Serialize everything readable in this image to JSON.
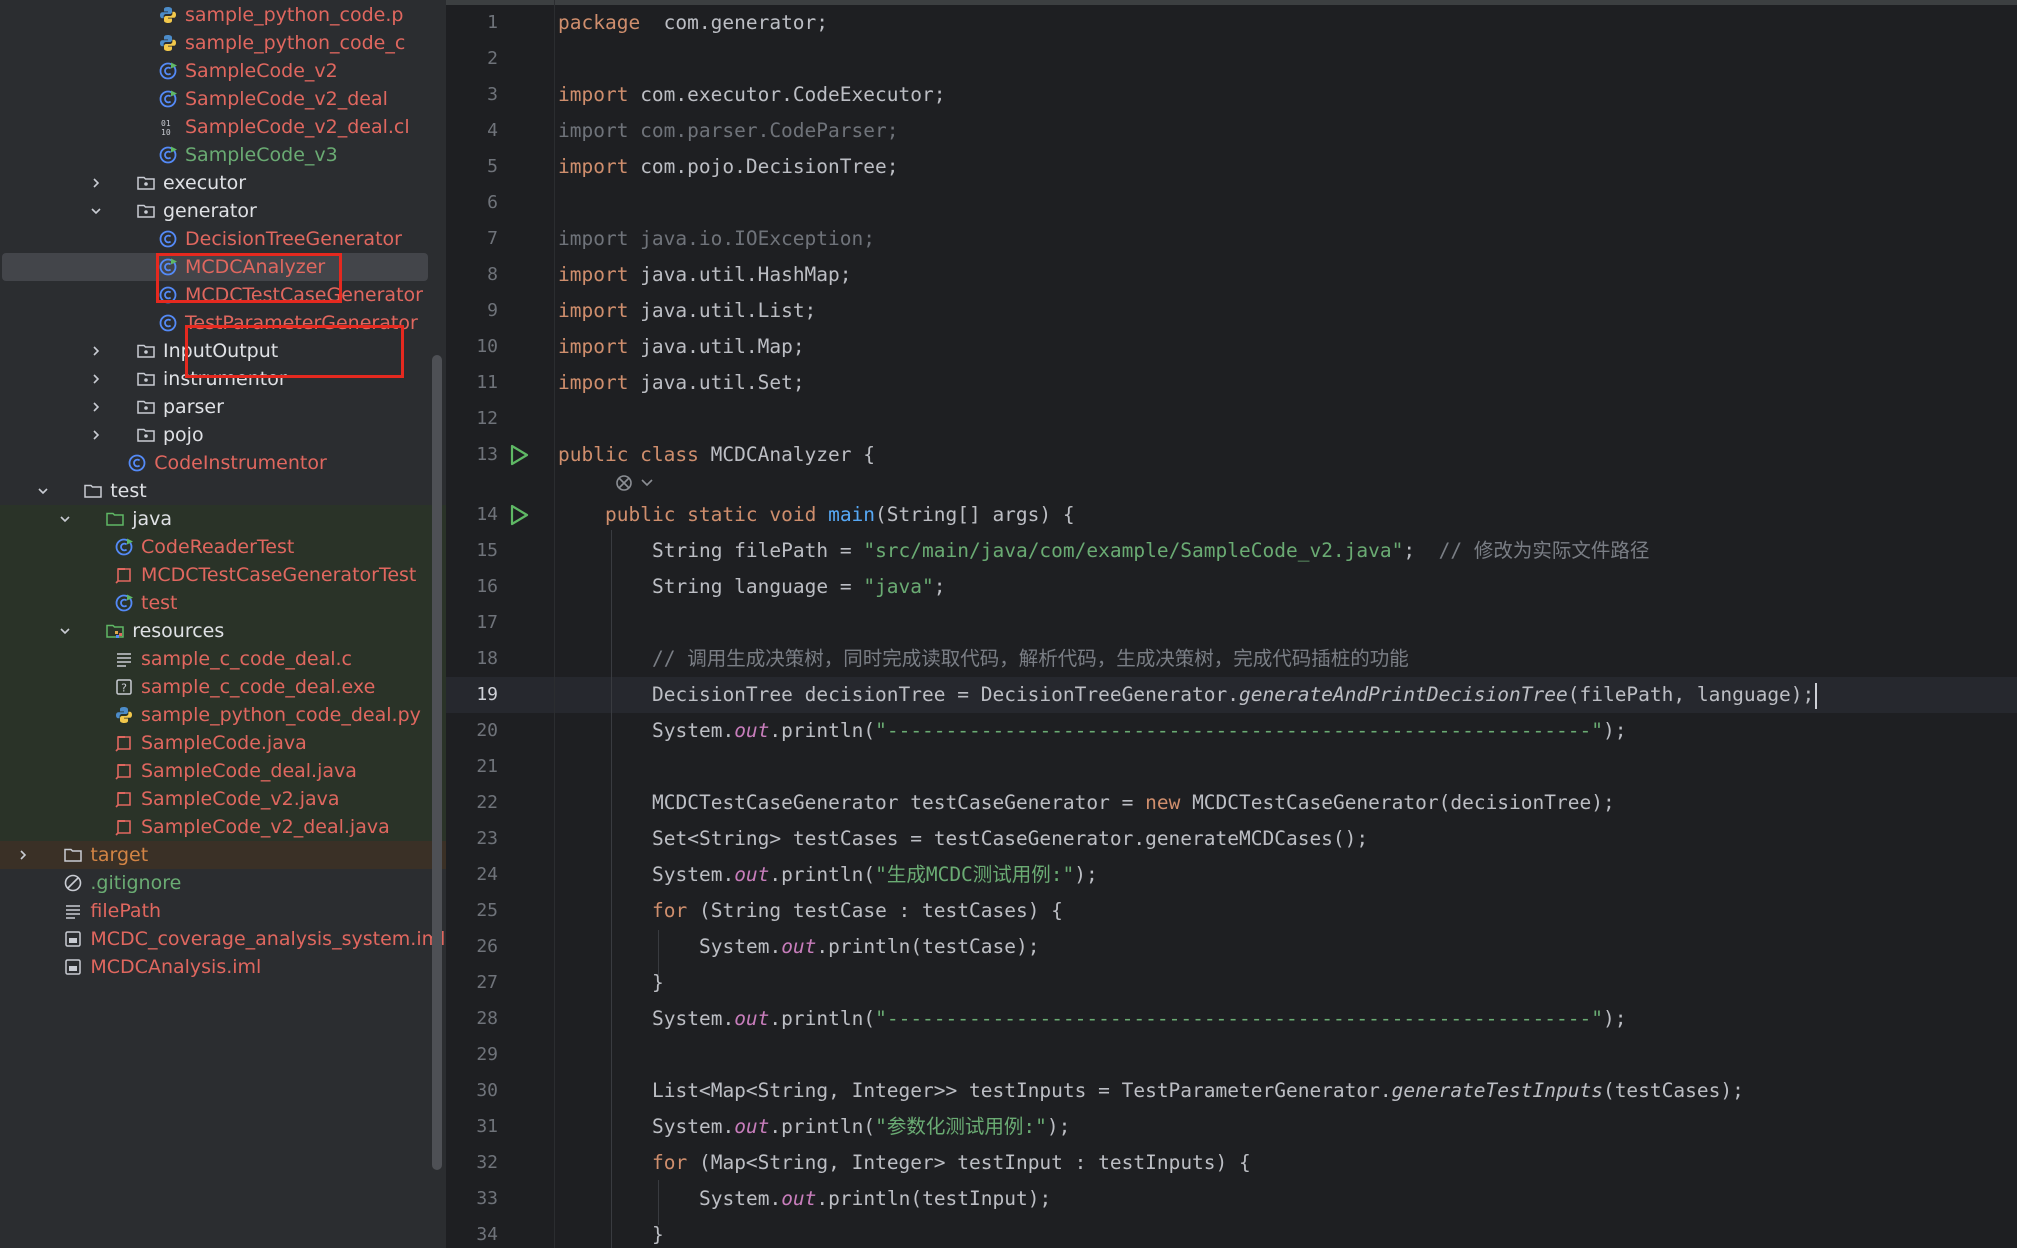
{
  "tree": {
    "items": [
      {
        "label": "sample_python_code.p",
        "icon": "python-file-icon",
        "color": "red",
        "indent": 2,
        "arrow": "none",
        "bg": "none"
      },
      {
        "label": "sample_python_code_c",
        "icon": "python-file-icon",
        "color": "red",
        "indent": 2,
        "arrow": "none",
        "bg": "none"
      },
      {
        "label": "SampleCode_v2",
        "icon": "java-class-runnable-icon",
        "color": "red",
        "indent": 2,
        "arrow": "none",
        "bg": "none"
      },
      {
        "label": "SampleCode_v2_deal",
        "icon": "java-class-runnable-icon",
        "color": "red",
        "indent": 2,
        "arrow": "none",
        "bg": "none"
      },
      {
        "label": "SampleCode_v2_deal.cl",
        "icon": "binary-file-icon",
        "color": "red",
        "indent": 2,
        "arrow": "none",
        "bg": "none"
      },
      {
        "label": "SampleCode_v3",
        "icon": "java-class-runnable-icon",
        "color": "green",
        "indent": 2,
        "arrow": "none",
        "bg": "none"
      },
      {
        "label": "executor",
        "icon": "package-folder-icon",
        "color": "normal",
        "indent": 1,
        "arrow": "right",
        "bg": "none"
      },
      {
        "label": "generator",
        "icon": "package-folder-icon",
        "color": "normal",
        "indent": 1,
        "arrow": "down",
        "bg": "none"
      },
      {
        "label": "DecisionTreeGenerator",
        "icon": "java-class-icon",
        "color": "red",
        "indent": 2,
        "arrow": "none",
        "bg": "none"
      },
      {
        "label": "MCDCAnalyzer",
        "icon": "java-class-runnable-icon",
        "color": "red",
        "indent": 2,
        "arrow": "none",
        "bg": "none",
        "selected": true
      },
      {
        "label": "MCDCTestCaseGenerator",
        "icon": "java-class-icon",
        "color": "red",
        "indent": 2,
        "arrow": "none",
        "bg": "none"
      },
      {
        "label": "TestParameterGenerator",
        "icon": "java-class-icon",
        "color": "red",
        "indent": 2,
        "arrow": "none",
        "bg": "none"
      },
      {
        "label": "InputOutput",
        "icon": "package-folder-icon",
        "color": "normal",
        "indent": 1,
        "arrow": "right",
        "bg": "none"
      },
      {
        "label": "instrumentor",
        "icon": "package-folder-icon",
        "color": "normal",
        "indent": 1,
        "arrow": "right",
        "bg": "none"
      },
      {
        "label": "parser",
        "icon": "package-folder-icon",
        "color": "normal",
        "indent": 1,
        "arrow": "right",
        "bg": "none"
      },
      {
        "label": "pojo",
        "icon": "package-folder-icon",
        "color": "normal",
        "indent": 1,
        "arrow": "right",
        "bg": "none"
      },
      {
        "label": "CodeInstrumentor",
        "icon": "java-class-icon",
        "color": "red",
        "indent": 0.6,
        "arrow": "none",
        "bg": "none"
      },
      {
        "label": "test",
        "icon": "folder-icon",
        "color": "normal",
        "indent": -1.4,
        "arrow": "down",
        "bg": "none"
      },
      {
        "label": "java",
        "icon": "test-folder-icon",
        "color": "normal",
        "indent": -0.4,
        "arrow": "down",
        "bg": "green"
      },
      {
        "label": "CodeReaderTest",
        "icon": "java-class-runnable-icon",
        "color": "red",
        "indent": 0,
        "arrow": "none",
        "bg": "green"
      },
      {
        "label": "MCDCTestCaseGeneratorTest",
        "icon": "java-file-icon",
        "color": "red",
        "indent": 0,
        "arrow": "none",
        "bg": "green"
      },
      {
        "label": "test",
        "icon": "java-class-runnable-icon",
        "color": "red",
        "indent": 0,
        "arrow": "none",
        "bg": "green"
      },
      {
        "label": "resources",
        "icon": "resources-folder-icon",
        "color": "normal",
        "indent": -0.4,
        "arrow": "down",
        "bg": "green"
      },
      {
        "label": "sample_c_code_deal.c",
        "icon": "text-file-icon",
        "color": "red",
        "indent": 0,
        "arrow": "none",
        "bg": "green"
      },
      {
        "label": "sample_c_code_deal.exe",
        "icon": "unknown-file-icon",
        "color": "red",
        "indent": 0,
        "arrow": "none",
        "bg": "green"
      },
      {
        "label": "sample_python_code_deal.py",
        "icon": "python-file-icon",
        "color": "red",
        "indent": 0,
        "arrow": "none",
        "bg": "green"
      },
      {
        "label": "SampleCode.java",
        "icon": "java-file-icon",
        "color": "red",
        "indent": 0,
        "arrow": "none",
        "bg": "green"
      },
      {
        "label": "SampleCode_deal.java",
        "icon": "java-file-icon",
        "color": "red",
        "indent": 0,
        "arrow": "none",
        "bg": "green"
      },
      {
        "label": "SampleCode_v2.java",
        "icon": "java-file-icon",
        "color": "red",
        "indent": 0,
        "arrow": "none",
        "bg": "green"
      },
      {
        "label": "SampleCode_v2_deal.java",
        "icon": "java-file-icon",
        "color": "red",
        "indent": 0,
        "arrow": "none",
        "bg": "green"
      },
      {
        "label": "target",
        "icon": "folder-icon",
        "color": "orange",
        "indent": -2.3,
        "arrow": "right",
        "bg": "orange"
      },
      {
        "label": ".gitignore",
        "icon": "ignore-file-icon",
        "color": "green",
        "indent": -2.3,
        "arrow": "none",
        "bg": "none"
      },
      {
        "label": "filePath",
        "icon": "text-file-icon",
        "color": "red",
        "indent": -2.3,
        "arrow": "none",
        "bg": "none"
      },
      {
        "label": "MCDC_coverage_analysis_system.iml",
        "icon": "module-file-icon",
        "color": "red",
        "indent": -2.3,
        "arrow": "none",
        "bg": "none"
      },
      {
        "label": "MCDCAnalysis.iml",
        "icon": "module-file-icon",
        "color": "red",
        "indent": -2.3,
        "arrow": "none",
        "bg": "none"
      }
    ]
  },
  "editor": {
    "active_line": 19,
    "lines": [
      {
        "n": 1,
        "indent": 0,
        "parts": [
          [
            "kw",
            "package"
          ],
          [
            "",
            "  com.generator;"
          ]
        ]
      },
      {
        "n": 2,
        "indent": 0,
        "parts": []
      },
      {
        "n": 3,
        "indent": 0,
        "parts": [
          [
            "kw",
            "import"
          ],
          [
            "",
            " com.executor.CodeExecutor;"
          ]
        ]
      },
      {
        "n": 4,
        "indent": 0,
        "parts": [
          [
            "dim",
            "import com.parser.CodeParser;"
          ]
        ]
      },
      {
        "n": 5,
        "indent": 0,
        "parts": [
          [
            "kw",
            "import"
          ],
          [
            "",
            " com.pojo.DecisionTree;"
          ]
        ]
      },
      {
        "n": 6,
        "indent": 0,
        "parts": []
      },
      {
        "n": 7,
        "indent": 0,
        "parts": [
          [
            "dim",
            "import java.io.IOException;"
          ]
        ]
      },
      {
        "n": 8,
        "indent": 0,
        "parts": [
          [
            "kw",
            "import"
          ],
          [
            "",
            " java.util.HashMap;"
          ]
        ]
      },
      {
        "n": 9,
        "indent": 0,
        "parts": [
          [
            "kw",
            "import"
          ],
          [
            "",
            " java.util.List;"
          ]
        ]
      },
      {
        "n": 10,
        "indent": 0,
        "parts": [
          [
            "kw",
            "import"
          ],
          [
            "",
            " java.util.Map;"
          ]
        ]
      },
      {
        "n": 11,
        "indent": 0,
        "parts": [
          [
            "kw",
            "import"
          ],
          [
            "",
            " java.util.Set;"
          ]
        ]
      },
      {
        "n": 12,
        "indent": 0,
        "parts": []
      },
      {
        "n": 13,
        "indent": 0,
        "run": true,
        "parts": [
          [
            "kw",
            "public class"
          ],
          [
            "",
            " MCDCAnalyzer {"
          ]
        ]
      },
      {
        "n": 14,
        "indent": 1,
        "run": true,
        "parts": [
          [
            "kw",
            "public static void"
          ],
          [
            "",
            " "
          ],
          [
            "fn",
            "main"
          ],
          [
            "",
            "(String[] args) {"
          ]
        ]
      },
      {
        "n": 15,
        "indent": 2,
        "parts": [
          [
            "",
            "String filePath = "
          ],
          [
            "str",
            "\"src/main/java/com/example/SampleCode_v2.java\""
          ],
          [
            "",
            ";  "
          ],
          [
            "cmt",
            "// 修改为实际文件路径"
          ]
        ]
      },
      {
        "n": 16,
        "indent": 2,
        "parts": [
          [
            "",
            "String language = "
          ],
          [
            "str",
            "\"java\""
          ],
          [
            "",
            ";"
          ]
        ]
      },
      {
        "n": 17,
        "indent": 2,
        "parts": []
      },
      {
        "n": 18,
        "indent": 2,
        "parts": [
          [
            "cmt",
            "// 调用生成决策树，同时完成读取代码，解析代码，生成决策树，完成代码插桩的功能"
          ]
        ]
      },
      {
        "n": 19,
        "indent": 2,
        "caret": true,
        "parts": [
          [
            "",
            "DecisionTree decisionTree = DecisionTreeGenerator."
          ],
          [
            "it",
            "generateAndPrintDecisionTree"
          ],
          [
            "",
            "(filePath, language);"
          ]
        ]
      },
      {
        "n": 20,
        "indent": 2,
        "parts": [
          [
            "",
            "System."
          ],
          [
            "st",
            "out"
          ],
          [
            "",
            ".println("
          ],
          [
            "str",
            "\"------------------------------------------------------------\""
          ],
          [
            "",
            ");"
          ]
        ]
      },
      {
        "n": 21,
        "indent": 2,
        "parts": []
      },
      {
        "n": 22,
        "indent": 2,
        "parts": [
          [
            "",
            "MCDCTestCaseGenerator testCaseGenerator = "
          ],
          [
            "kw",
            "new"
          ],
          [
            "",
            " MCDCTestCaseGenerator(decisionTree);"
          ]
        ]
      },
      {
        "n": 23,
        "indent": 2,
        "parts": [
          [
            "",
            "Set<String> testCases = testCaseGenerator.generateMCDCases();"
          ]
        ]
      },
      {
        "n": 24,
        "indent": 2,
        "parts": [
          [
            "",
            "System."
          ],
          [
            "st",
            "out"
          ],
          [
            "",
            ".println("
          ],
          [
            "str",
            "\"生成MCDC测试用例:\""
          ],
          [
            "",
            ");"
          ]
        ]
      },
      {
        "n": 25,
        "indent": 2,
        "parts": [
          [
            "kw",
            "for"
          ],
          [
            "",
            " (String testCase : testCases) {"
          ]
        ]
      },
      {
        "n": 26,
        "indent": 3,
        "parts": [
          [
            "",
            "System."
          ],
          [
            "st",
            "out"
          ],
          [
            "",
            ".println(testCase);"
          ]
        ]
      },
      {
        "n": 27,
        "indent": 2,
        "parts": [
          [
            "",
            "}"
          ]
        ]
      },
      {
        "n": 28,
        "indent": 2,
        "parts": [
          [
            "",
            "System."
          ],
          [
            "st",
            "out"
          ],
          [
            "",
            ".println("
          ],
          [
            "str",
            "\"------------------------------------------------------------\""
          ],
          [
            "",
            ");"
          ]
        ]
      },
      {
        "n": 29,
        "indent": 2,
        "parts": []
      },
      {
        "n": 30,
        "indent": 2,
        "parts": [
          [
            "",
            "List<Map<String, Integer>> testInputs = TestParameterGenerator."
          ],
          [
            "it",
            "generateTestInputs"
          ],
          [
            "",
            "(testCases);"
          ]
        ]
      },
      {
        "n": 31,
        "indent": 2,
        "parts": [
          [
            "",
            "System."
          ],
          [
            "st",
            "out"
          ],
          [
            "",
            ".println("
          ],
          [
            "str",
            "\"参数化测试用例:\""
          ],
          [
            "",
            ");"
          ]
        ]
      },
      {
        "n": 32,
        "indent": 2,
        "parts": [
          [
            "kw",
            "for"
          ],
          [
            "",
            " (Map<String, Integer> testInput : testInputs) {"
          ]
        ]
      },
      {
        "n": 33,
        "indent": 3,
        "parts": [
          [
            "",
            "System."
          ],
          [
            "st",
            "out"
          ],
          [
            "",
            ".println(testInput);"
          ]
        ]
      },
      {
        "n": 34,
        "indent": 2,
        "parts": [
          [
            "",
            "}"
          ]
        ]
      }
    ]
  }
}
